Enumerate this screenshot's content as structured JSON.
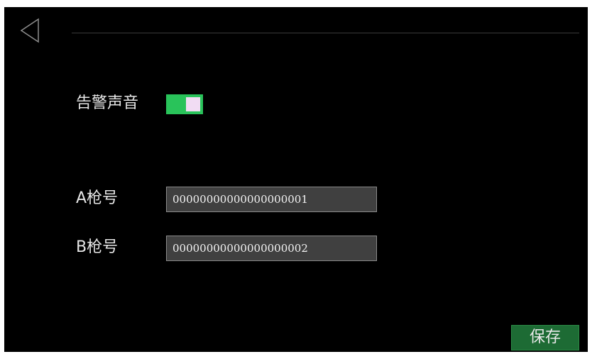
{
  "icons": {
    "back": "back-arrow-icon"
  },
  "alarm": {
    "label": "告警声音",
    "enabled": true
  },
  "gun_a": {
    "label": "A枪号",
    "value": "00000000000000000001"
  },
  "gun_b": {
    "label": "B枪号",
    "value": "00000000000000000002"
  },
  "actions": {
    "save_label": "保存"
  },
  "colors": {
    "background": "#000000",
    "toggle_on": "#29c35a",
    "save_button": "#1d6b34",
    "field_bg": "#404040"
  }
}
